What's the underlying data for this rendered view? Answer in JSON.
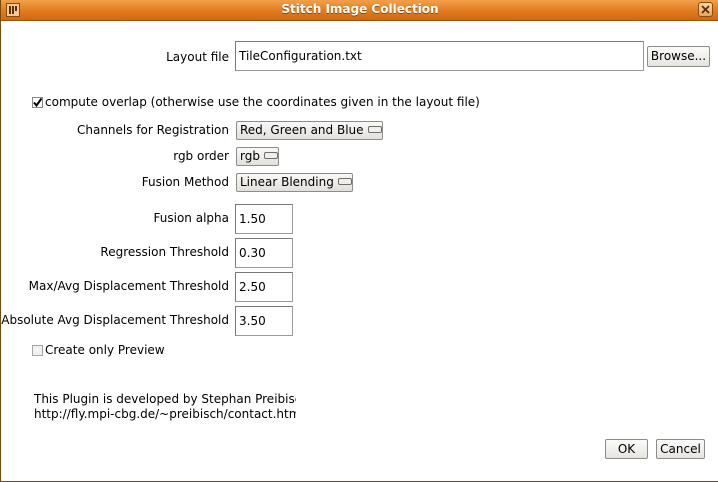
{
  "window": {
    "title": "Stitch Image Collection"
  },
  "layout_file": {
    "label": "Layout file",
    "value": "TileConfiguration.txt",
    "browse_label": "Browse..."
  },
  "compute_overlap": {
    "label": "compute overlap (otherwise use the coordinates given in the layout file)",
    "checked": true
  },
  "channels": {
    "label": "Channels for Registration",
    "value": "Red, Green and Blue"
  },
  "rgb_order": {
    "label": "rgb order",
    "value": "rgb"
  },
  "fusion_method": {
    "label": "Fusion Method",
    "value": "Linear Blending"
  },
  "fusion_alpha": {
    "label": "Fusion alpha",
    "value": "1.50"
  },
  "regression_threshold": {
    "label": "Regression Threshold",
    "value": "0.30"
  },
  "max_avg_displacement": {
    "label": "Max/Avg Displacement Threshold",
    "value": "2.50"
  },
  "absolute_avg_displacement": {
    "label": "Absolute Avg Displacement Threshold",
    "value": "3.50"
  },
  "create_preview": {
    "label": "Create only Preview",
    "checked": false
  },
  "info": {
    "line1": "This Plugin is developed by Stephan Preibisch",
    "line2": "http://fly.mpi-cbg.de/~preibisch/contact.html"
  },
  "buttons": {
    "ok": "OK",
    "cancel": "Cancel"
  },
  "icons": {
    "app": "imagej-icon",
    "close": "close-icon",
    "check": "checkmark-icon",
    "combo": "combo-arrow-icon"
  },
  "colors": {
    "titlebar": "#e07a1f",
    "background": "#ffffff"
  }
}
